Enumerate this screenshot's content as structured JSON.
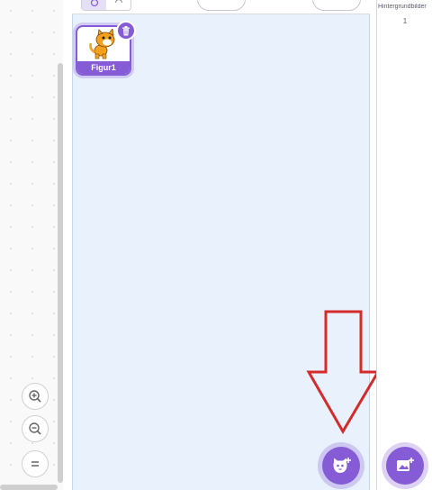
{
  "sprite_pane": {
    "sprite": {
      "name": "Figur1"
    }
  },
  "stage": {
    "label": "Hintergrundbilder",
    "count": "1"
  },
  "colors": {
    "accent": "#855cd6",
    "pane_bg": "#e9f1fc",
    "annotation": "#d42b2b"
  },
  "icons": [
    "zoom-in-icon",
    "zoom-out-icon",
    "zoom-reset-icon",
    "trash-icon",
    "choose-sprite-icon",
    "choose-backdrop-icon"
  ]
}
